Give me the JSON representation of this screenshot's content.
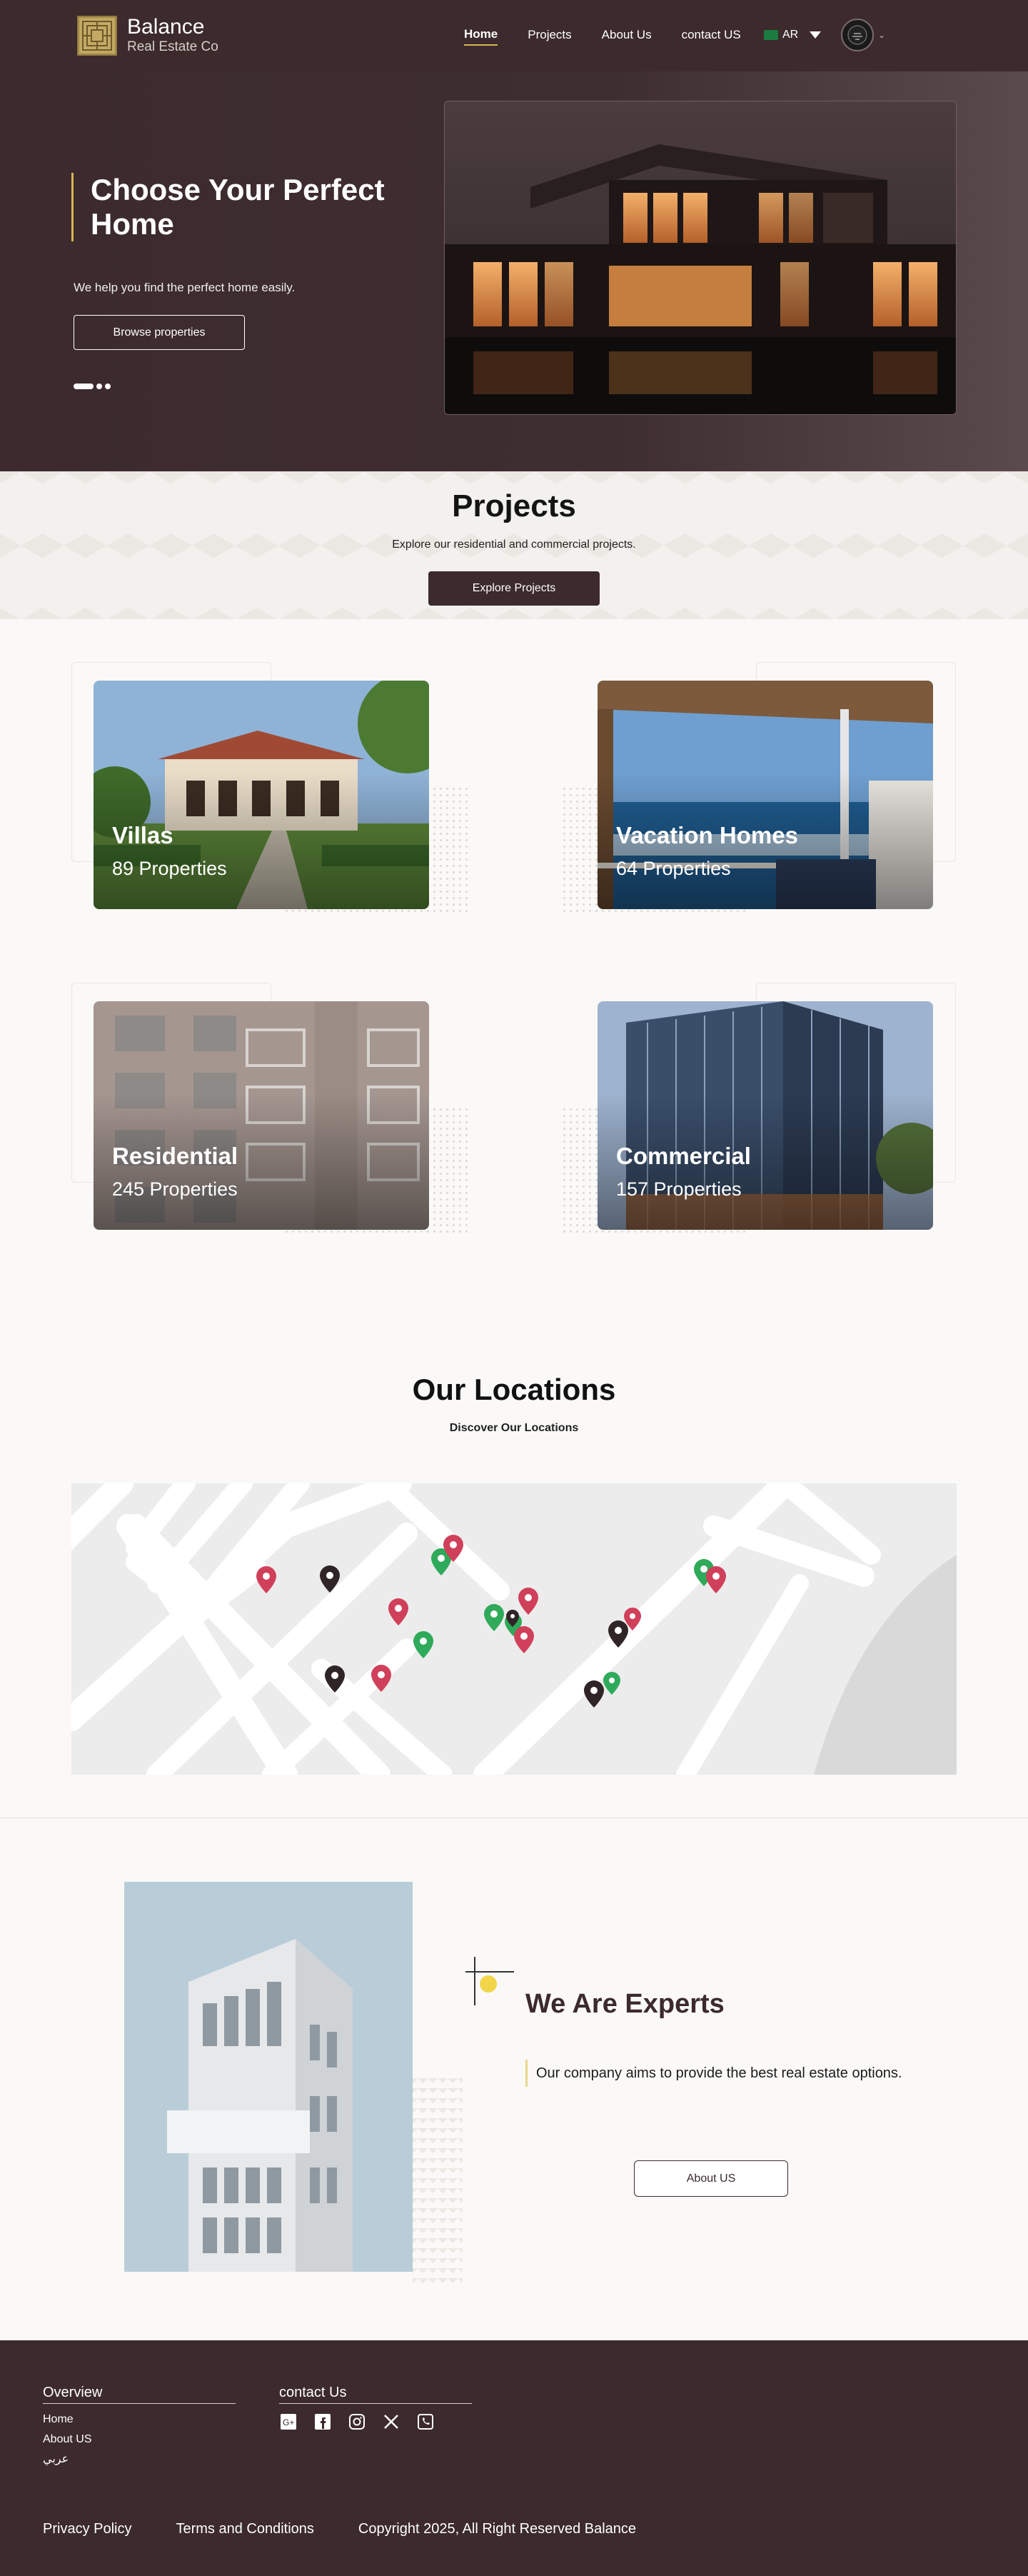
{
  "header": {
    "logo_title": "Balance",
    "logo_subtitle": "Real Estate Co",
    "nav": [
      {
        "label": "Home",
        "active": true
      },
      {
        "label": "Projects",
        "active": false
      },
      {
        "label": "About Us",
        "active": false
      },
      {
        "label": "contact US",
        "active": false
      }
    ],
    "language": "AR"
  },
  "hero": {
    "title": "Choose Your Perfect Home",
    "subtitle": "We help you find the perfect home easily.",
    "cta": "Browse properties",
    "slides": 3,
    "active_slide": 1
  },
  "projects": {
    "title": "Projects",
    "subtitle": "Explore our residential and commercial projects.",
    "cta": "Explore Projects",
    "categories": [
      {
        "name": "Villas",
        "count": "89 Properties"
      },
      {
        "name": "Vacation Homes",
        "count": "64 Properties"
      },
      {
        "name": "Residential",
        "count": "245 Properties"
      },
      {
        "name": "Commercial",
        "count": "157 Properties"
      }
    ]
  },
  "locations": {
    "title": "Our Locations",
    "subtitle": "Discover Our Locations"
  },
  "experts": {
    "title": "We Are Experts",
    "text": "Our company aims to provide the best real estate options.",
    "cta": "About US"
  },
  "footer": {
    "overview_title": "Overview",
    "overview_links": [
      "Home",
      "About US",
      "عربي"
    ],
    "contact_title": "contact Us",
    "socials": [
      "google-plus-icon",
      "facebook-icon",
      "instagram-icon",
      "x-icon",
      "phone-icon"
    ],
    "bottom": {
      "privacy": "Privacy Policy",
      "terms": "Terms and Conditions",
      "copyright": "Copyright 2025, All Right Reserved Balance"
    }
  },
  "colors": {
    "brand": "#3c2a2d",
    "accent": "#d7b654",
    "pin_red": "#d0405a",
    "pin_green": "#2faa5a",
    "pin_dark": "#2f2426"
  }
}
